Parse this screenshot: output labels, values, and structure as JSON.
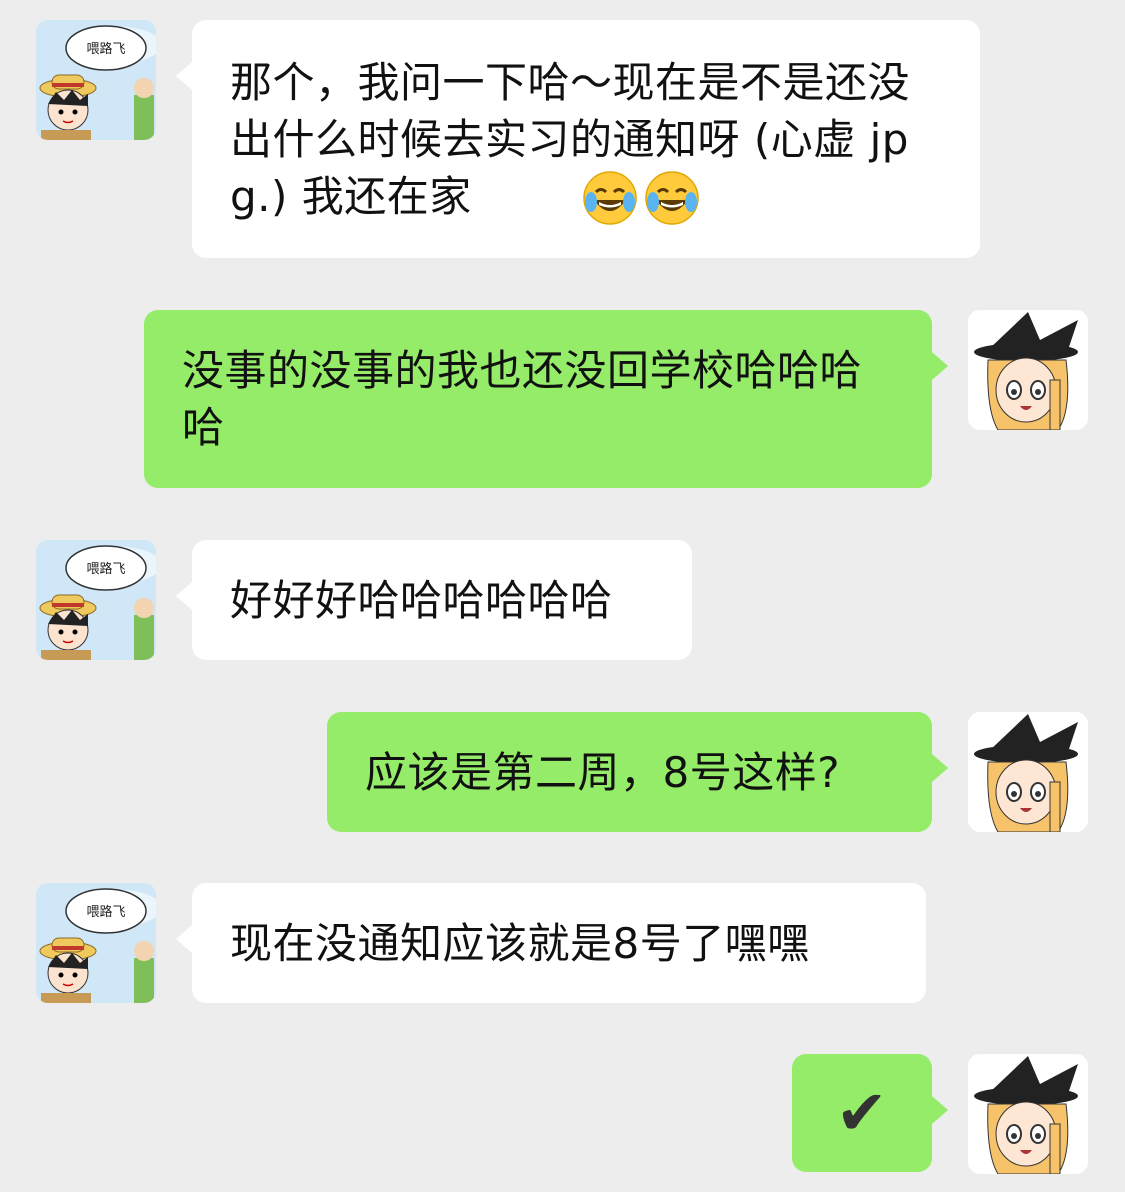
{
  "left_avatar": {
    "caption": "喂路飞"
  },
  "messages": [
    {
      "side": "left",
      "text": "那个，我问一下哈～现在是不是还没出什么时候去实习的通知呀 (心虚 jpg.) 我还在家",
      "emojis": [
        "face-with-tears-of-joy",
        "face-with-tears-of-joy"
      ]
    },
    {
      "side": "right",
      "text": "没事的没事的我也还没回学校哈哈哈哈"
    },
    {
      "side": "left",
      "text": "好好好哈哈哈哈哈哈"
    },
    {
      "side": "right",
      "text": "应该是第二周，8号这样?"
    },
    {
      "side": "left",
      "text": "现在没通知应该就是8号了嘿嘿"
    },
    {
      "side": "right",
      "text": "✔"
    }
  ]
}
